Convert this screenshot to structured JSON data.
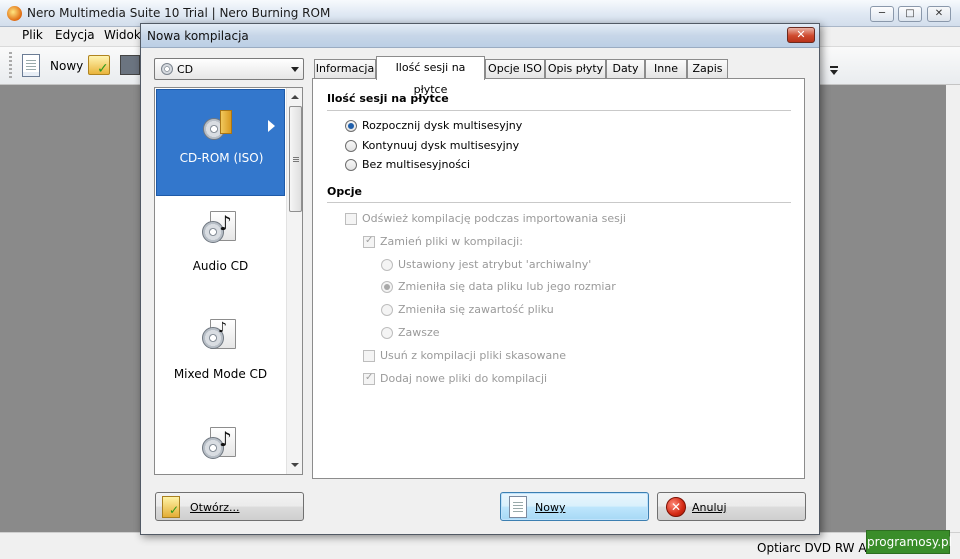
{
  "main_window": {
    "title": "Nero Multimedia Suite 10 Trial | Nero Burning ROM",
    "controls": {
      "minimize": "─",
      "maximize": "□",
      "close": "✕"
    }
  },
  "menu": [
    "Plik",
    "Edycja",
    "Widok"
  ],
  "toolbar": {
    "new_label": "Nowy"
  },
  "status": {
    "drive": "Optiarc  DVD RW AD"
  },
  "watermark": "programosy.pl",
  "dialog": {
    "title": "Nowa kompilacja",
    "close_glyph": "✕",
    "disc_type": "CD",
    "compilation_types": [
      {
        "label": "CD-ROM (ISO)",
        "icon": "disc-folder-icon"
      },
      {
        "label": "Audio CD",
        "icon": "disc-music-icon"
      },
      {
        "label": "Mixed Mode CD",
        "icon": "disc-mixed-icon"
      },
      {
        "label": "",
        "icon": "disc-music-icon"
      }
    ],
    "tabs": [
      "Informacja",
      "Ilość sesji na płytce",
      "Opcje ISO",
      "Opis płyty",
      "Daty",
      "Inne",
      "Zapis"
    ],
    "active_tab": "Ilość sesji na płytce",
    "session": {
      "title": "Ilość sesji na płytce",
      "options": [
        "Rozpocznij dysk multisesyjny",
        "Kontynuuj dysk multisesyjny",
        "Bez multisesyjności"
      ],
      "selected": "Rozpocznij dysk multisesyjny"
    },
    "options_section": {
      "title": "Opcje",
      "refresh": "Odśwież kompilację podczas importowania sesji",
      "replace": "Zamień pliki w kompilacji:",
      "replace_modes": [
        "Ustawiony jest atrybut 'archiwalny'",
        "Zmieniła się data pliku lub jego rozmiar",
        "Zmieniła się zawartość pliku",
        "Zawsze"
      ],
      "remove_deleted": "Usuń z kompilacji pliki skasowane",
      "add_new": "Dodaj nowe pliki do kompilacji"
    },
    "buttons": {
      "open": "Otwórz...",
      "new": "Nowy",
      "cancel": "Anuluj"
    }
  }
}
